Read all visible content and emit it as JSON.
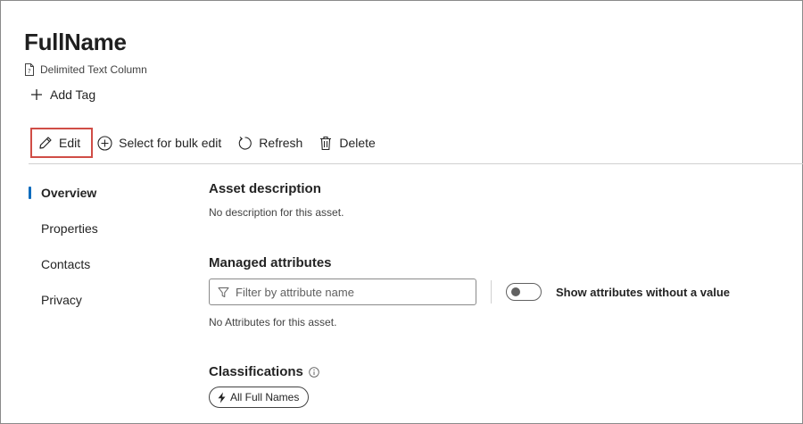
{
  "header": {
    "title": "FullName",
    "asset_type": "Delimited Text Column",
    "add_tag_label": "Add Tag"
  },
  "toolbar": {
    "edit_label": "Edit",
    "bulk_edit_label": "Select for bulk edit",
    "refresh_label": "Refresh",
    "delete_label": "Delete"
  },
  "nav": {
    "items": [
      {
        "label": "Overview",
        "active": true
      },
      {
        "label": "Properties",
        "active": false
      },
      {
        "label": "Contacts",
        "active": false
      },
      {
        "label": "Privacy",
        "active": false
      }
    ]
  },
  "overview": {
    "description_heading": "Asset description",
    "description_empty": "No description for this asset.",
    "managed_heading": "Managed attributes",
    "filter_placeholder": "Filter by attribute name",
    "filter_value": "",
    "toggle_label": "Show attributes without a value",
    "toggle_on": false,
    "attributes_empty": "No Attributes for this asset.",
    "classifications_heading": "Classifications",
    "classifications": [
      "All Full Names"
    ]
  },
  "colors": {
    "accent": "#0f6cbd",
    "highlight_border": "#d04d46",
    "text": "#242424"
  }
}
